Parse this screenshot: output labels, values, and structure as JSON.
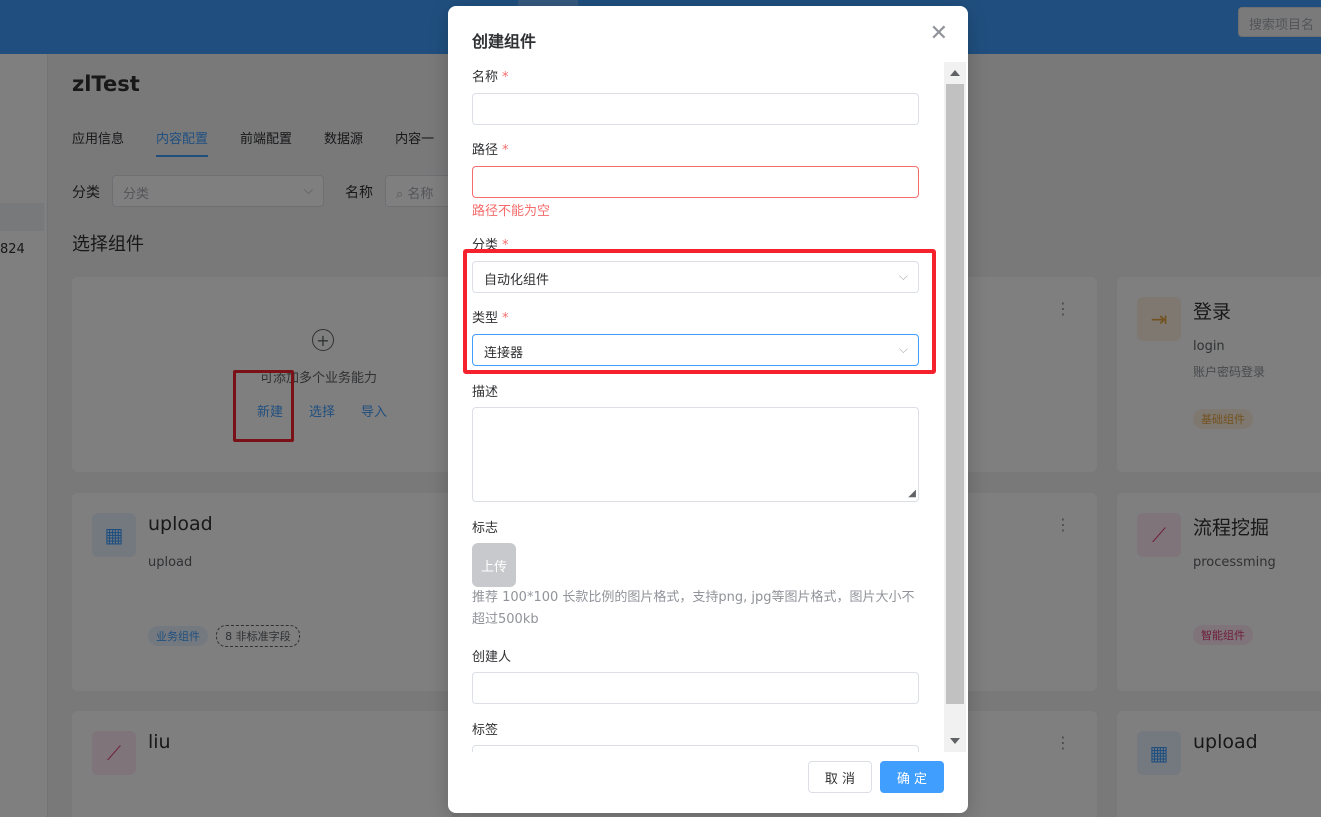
{
  "topbar": {
    "search_placeholder": "搜索项目名"
  },
  "leftnav": {
    "number": "824"
  },
  "app": {
    "title": "zlTest"
  },
  "tabs": [
    {
      "label": "应用信息"
    },
    {
      "label": "内容配置"
    },
    {
      "label": "前端配置"
    },
    {
      "label": "数据源"
    },
    {
      "label": "内容一"
    }
  ],
  "filter": {
    "category_label": "分类",
    "category_placeholder": "分类",
    "name_label": "名称",
    "name_placeholder": "名称"
  },
  "section_title": "选择组件",
  "new_card": {
    "hint": "可添加多个业务能力",
    "new_label": "新建",
    "select_label": "选择",
    "import_label": "导入"
  },
  "cards": {
    "login": {
      "name": "登录",
      "code": "login",
      "desc": "账户密码登录",
      "tag": "基础组件"
    },
    "upload": {
      "name": "upload",
      "code": "upload",
      "tag": "业务组件",
      "extra_tag": "8 非标准字段"
    },
    "process": {
      "name": "流程挖掘",
      "code": "processming",
      "tag": "智能组件"
    },
    "liu": {
      "name": "liu"
    },
    "upload2": {
      "name": "upload"
    }
  },
  "dialog": {
    "title": "创建组件",
    "required_mark": "*",
    "name_label": "名称",
    "name_value": "",
    "path_label": "路径",
    "path_value": "",
    "path_error": "路径不能为空",
    "category_label": "分类",
    "category_value": "自动化组件",
    "type_label": "类型",
    "type_value": "连接器",
    "desc_label": "描述",
    "logo_label": "标志",
    "upload_label": "上传",
    "upload_hint": "推荐 100*100 长款比例的图片格式，支持png, jpg等图片格式，图片大小不超过500kb",
    "creator_label": "创建人",
    "creator_value": "",
    "tags_label": "标签",
    "cancel_label": "取 消",
    "confirm_label": "确 定"
  },
  "colors": {
    "primary": "#409eff",
    "error": "#f56c6c",
    "annotation_red": "#f5222d"
  }
}
